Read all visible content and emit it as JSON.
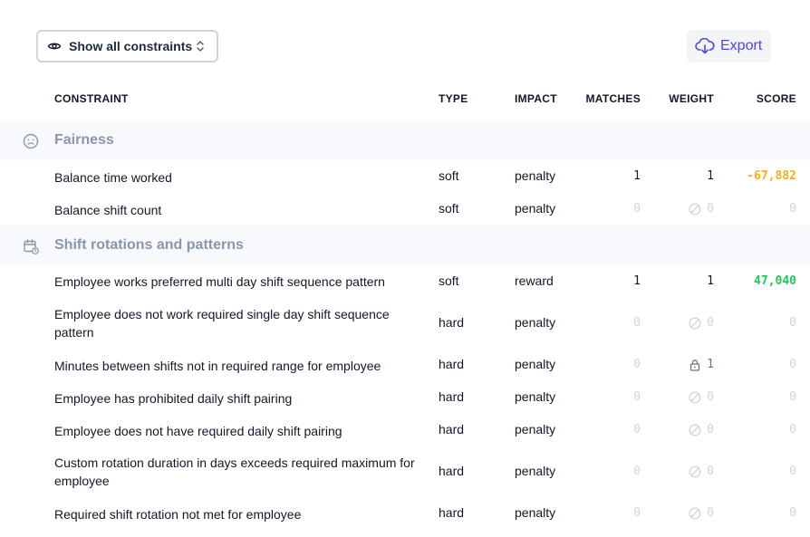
{
  "toolbar": {
    "filter_label": "Show all constraints",
    "filter_icon": "eye-icon",
    "export_label": "Export",
    "export_icon": "cloud-download-icon"
  },
  "table": {
    "headers": {
      "constraint": "CONSTRAINT",
      "type": "TYPE",
      "impact": "IMPACT",
      "matches": "MATCHES",
      "weight": "WEIGHT",
      "score": "SCORE"
    },
    "groups": [
      {
        "name": "Fairness",
        "icon": "face-icon",
        "rows": [
          {
            "name": "Balance time worked",
            "type": "soft",
            "impact": "penalty",
            "matches": "1",
            "weight": "1",
            "weight_icon": "",
            "score": "-67,882",
            "score_style": "neg"
          },
          {
            "name": "Balance shift count",
            "type": "soft",
            "impact": "penalty",
            "matches": "0",
            "weight": "0",
            "weight_icon": "disabled-icon",
            "score": "0",
            "score_style": "zero"
          }
        ]
      },
      {
        "name": "Shift rotations and patterns",
        "icon": "calendar-cycle-icon",
        "rows": [
          {
            "name": "Employee works preferred multi day shift sequence pattern",
            "type": "soft",
            "impact": "reward",
            "matches": "1",
            "weight": "1",
            "weight_icon": "",
            "score": "47,040",
            "score_style": "pos"
          },
          {
            "name": "Employee does not work required single day shift sequence pattern",
            "type": "hard",
            "impact": "penalty",
            "matches": "0",
            "weight": "0",
            "weight_icon": "disabled-icon",
            "score": "0",
            "score_style": "zero"
          },
          {
            "name": "Minutes between shifts not in required range for employee",
            "type": "hard",
            "impact": "penalty",
            "matches": "0",
            "weight": "1",
            "weight_icon": "lock-icon",
            "score": "0",
            "score_style": "zero"
          },
          {
            "name": "Employee has prohibited daily shift pairing",
            "type": "hard",
            "impact": "penalty",
            "matches": "0",
            "weight": "0",
            "weight_icon": "disabled-icon",
            "score": "0",
            "score_style": "zero"
          },
          {
            "name": "Employee does not have required daily shift pairing",
            "type": "hard",
            "impact": "penalty",
            "matches": "0",
            "weight": "0",
            "weight_icon": "disabled-icon",
            "score": "0",
            "score_style": "zero"
          },
          {
            "name": "Custom rotation duration in days exceeds required maximum for employee",
            "type": "hard",
            "impact": "penalty",
            "matches": "0",
            "weight": "0",
            "weight_icon": "disabled-icon",
            "score": "0",
            "score_style": "zero"
          },
          {
            "name": "Required shift rotation not met for employee",
            "type": "hard",
            "impact": "penalty",
            "matches": "0",
            "weight": "0",
            "weight_icon": "disabled-icon",
            "score": "0",
            "score_style": "zero"
          }
        ]
      }
    ]
  },
  "colors": {
    "accent": "#4f46e5",
    "negative_score": "#f5b014",
    "positive_score": "#22c55e",
    "group_bg": "#f8f9fc",
    "group_text": "#8b95ab"
  }
}
